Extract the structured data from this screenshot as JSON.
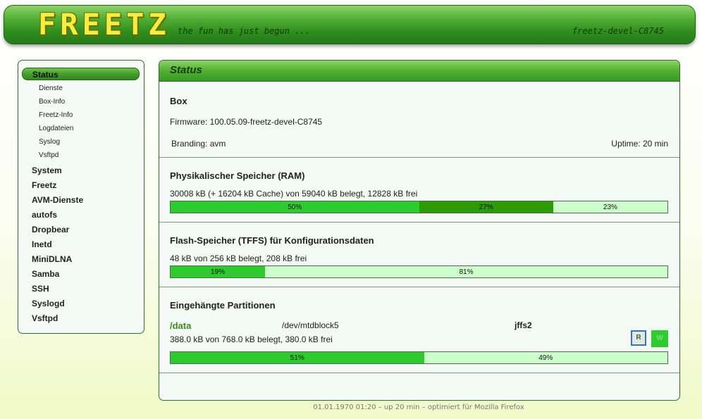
{
  "header": {
    "logo": "FREETZ",
    "tagline": "the fun has just begun ...",
    "version": "freetz-devel-C8745"
  },
  "sidebar": {
    "active": "Status",
    "sub_items": [
      "Dienste",
      "Box-Info",
      "Freetz-Info",
      "Logdateien",
      "Syslog",
      "Vsftpd"
    ],
    "items": [
      "System",
      "Freetz",
      "AVM-Dienste",
      "autofs",
      "Dropbear",
      "Inetd",
      "MiniDLNA",
      "Samba",
      "SSH",
      "Syslogd",
      "Vsftpd"
    ]
  },
  "main": {
    "title": "Status",
    "box": {
      "heading": "Box",
      "firmware": "Firmware: 100.05.09-freetz-devel-C8745",
      "branding": "Branding: avm",
      "uptime": "Uptime: 20 min"
    },
    "ram": {
      "heading": "Physikalischer Speicher (RAM)",
      "summary": "30008 kB (+ 16204 kB Cache) von 59040 kB belegt, 12828 kB frei",
      "used_pct": 50,
      "used_label": "50%",
      "cache_pct": 27,
      "cache_label": "27%",
      "free_pct": 23,
      "free_label": "23%"
    },
    "flash": {
      "heading": "Flash-Speicher (TFFS) für Konfigurationsdaten",
      "summary": "48 kB von 256 kB belegt, 208 kB frei",
      "used_pct": 19,
      "used_label": "19%",
      "free_pct": 81,
      "free_label": "81%"
    },
    "partitions": {
      "heading": "Eingehängte Partitionen",
      "mount": "/data",
      "device": "/dev/mtdblock5",
      "fs": "jffs2",
      "summary": "388.0 kB von 768.0 kB belegt, 380.0 kB frei",
      "read_label": "R",
      "write_label": "W",
      "used_pct": 51,
      "used_label": "51%",
      "free_pct": 49,
      "free_label": "49%"
    }
  },
  "footer": "01.01.1970 01:20 – up 20 min – optimiert für Mozilla Firefox",
  "colors": {
    "used": "#2ecb2e",
    "cache": "#2b9c05",
    "free": "#ccfecc"
  }
}
